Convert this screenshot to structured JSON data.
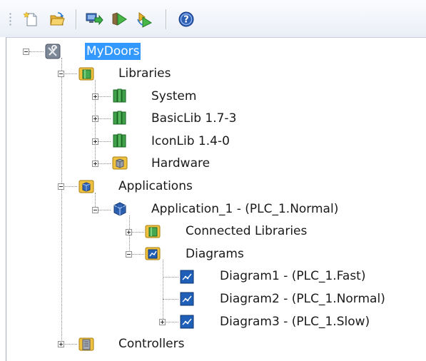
{
  "toolbar": {
    "buttons": [
      {
        "name": "new-file-icon"
      },
      {
        "name": "open-folder-icon"
      },
      {
        "name": "download-icon"
      },
      {
        "name": "run-icon"
      },
      {
        "name": "run-step-icon"
      },
      {
        "name": "help-icon"
      }
    ]
  },
  "tree": {
    "root": {
      "label": "MyDoors",
      "selected": true
    },
    "libraries": {
      "label": "Libraries",
      "children": [
        {
          "label": "System"
        },
        {
          "label": "BasicLib 1.7-3"
        },
        {
          "label": "IconLib 1.4-0"
        },
        {
          "label": "Hardware"
        }
      ]
    },
    "applications": {
      "label": "Applications",
      "application": {
        "label": "Application_1 - (PLC_1.Normal)",
        "connected_libraries": {
          "label": "Connected Libraries"
        },
        "diagrams": {
          "label": "Diagrams",
          "children": [
            {
              "label": "Diagram1 - (PLC_1.Fast)"
            },
            {
              "label": "Diagram2 - (PLC_1.Normal)"
            },
            {
              "label": "Diagram3 - (PLC_1.Slow)"
            }
          ]
        }
      }
    },
    "controllers": {
      "label": "Controllers"
    }
  },
  "colors": {
    "selection": "#3399ff",
    "library_green": "#3aa24a",
    "diagram_blue": "#1f5fb8",
    "folder_yellow": "#e8b830"
  }
}
